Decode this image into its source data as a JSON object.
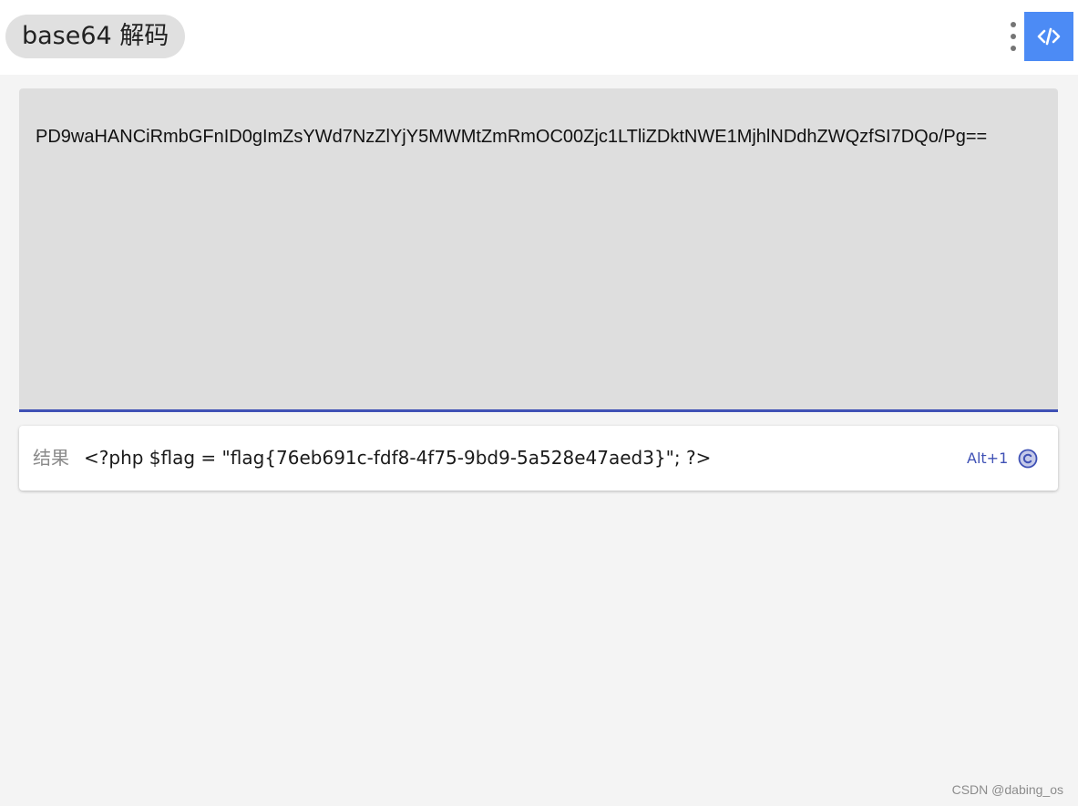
{
  "header": {
    "title": "base64 解码",
    "more_icon": "more-vertical-icon",
    "code_icon": "code-icon",
    "accent_color": "#4c8bf5"
  },
  "input": {
    "value": "PD9waHANCiRmbGFnID0gImZsYWd7NzZlYjY5MWMtZmRmOC00Zjc1LTliZDktNWE1MjhlNDdhZWQzfSI7DQo/Pg==",
    "underline_color": "#3f51b5"
  },
  "result": {
    "label": "结果",
    "value": "<?php $flag = \"flag{76eb691c-fdf8-4f75-9bd9-5a528e47aed3}\"; ?>",
    "shortcut": "Alt+1",
    "copy_icon": "copy-c-icon"
  },
  "footer": {
    "watermark": "CSDN @dabing_os"
  }
}
